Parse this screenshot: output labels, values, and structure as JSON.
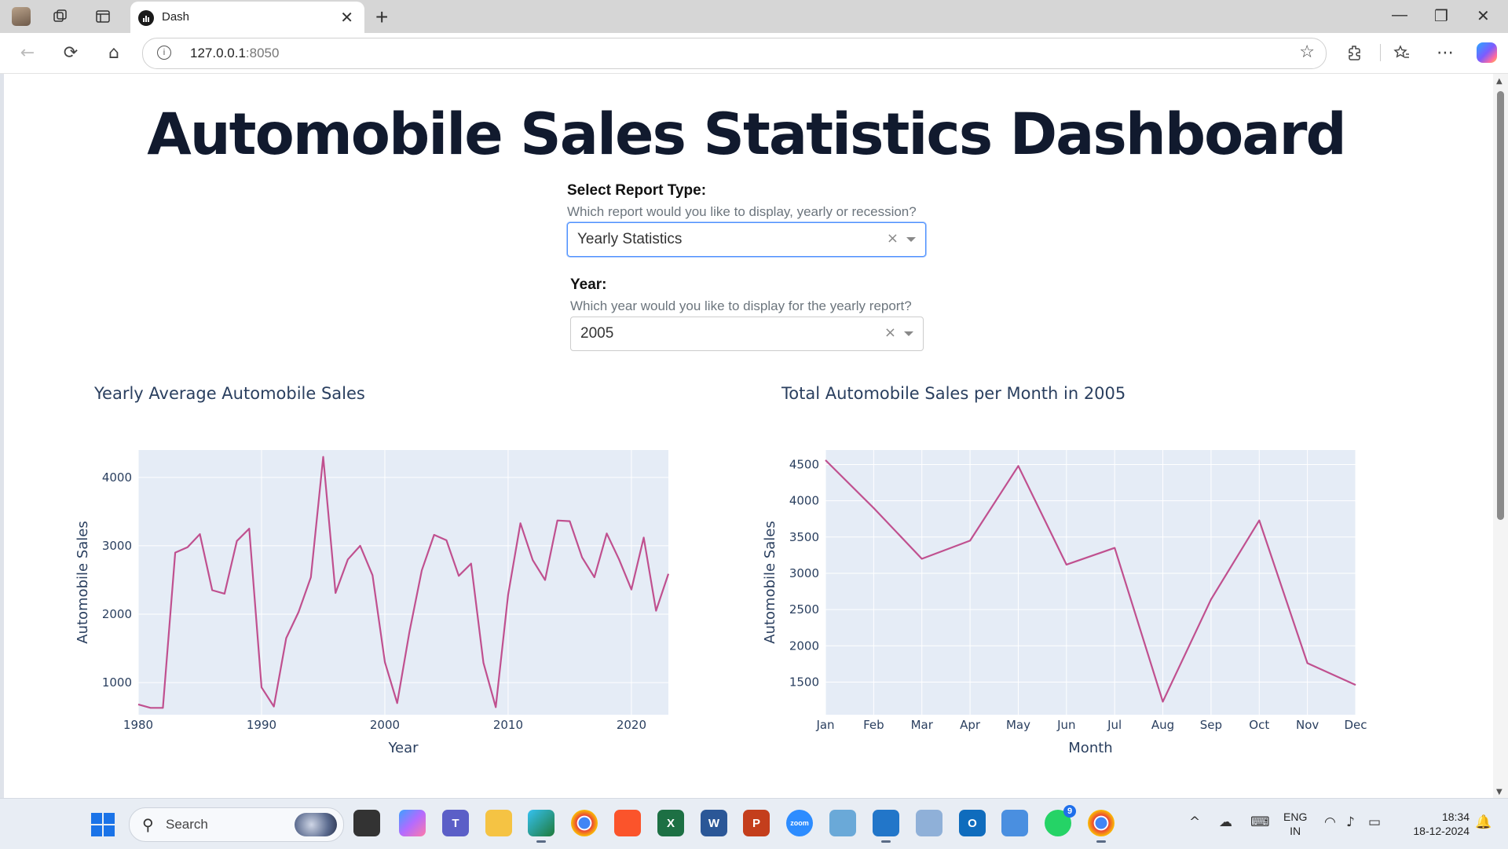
{
  "browser": {
    "tab_title": "Dash",
    "url_host": "127.0.0.1",
    "url_port": ":8050"
  },
  "page": {
    "title": "Automobile Sales Statistics Dashboard",
    "report_type": {
      "label": "Select Report Type:",
      "description": "Which report would you like to display, yearly or recession?",
      "value": "Yearly Statistics"
    },
    "year": {
      "label": "Year:",
      "description": "Which year would you like to display for the yearly report?",
      "value": "2005"
    }
  },
  "colors": {
    "line": "#c0508f",
    "plot_bg": "#e5ecf6",
    "grid": "#ffffff",
    "axis_text": "#2a3f5f",
    "title_text": "#111a2e"
  },
  "chart_data": [
    {
      "type": "line",
      "title": "Yearly Average Automobile Sales",
      "xlabel": "Year",
      "ylabel": "Automobile Sales",
      "xlim": [
        1980,
        2023
      ],
      "ylim": [
        530,
        4400
      ],
      "x_ticks": [
        1980,
        1990,
        2000,
        2010,
        2020
      ],
      "y_ticks": [
        1000,
        2000,
        3000,
        4000
      ],
      "grid": true,
      "x": [
        1980,
        1981,
        1982,
        1983,
        1984,
        1985,
        1986,
        1987,
        1988,
        1989,
        1990,
        1991,
        1992,
        1993,
        1994,
        1995,
        1996,
        1997,
        1998,
        1999,
        2000,
        2001,
        2002,
        2003,
        2004,
        2005,
        2006,
        2007,
        2008,
        2009,
        2010,
        2011,
        2012,
        2013,
        2014,
        2015,
        2016,
        2017,
        2018,
        2019,
        2020,
        2021,
        2022,
        2023
      ],
      "values": [
        680,
        630,
        630,
        2900,
        2980,
        3170,
        2350,
        2300,
        3070,
        3250,
        930,
        650,
        1650,
        2030,
        2540,
        4300,
        2310,
        2800,
        3000,
        2570,
        1300,
        700,
        1740,
        2640,
        3160,
        3080,
        2560,
        2740,
        1290,
        640,
        2280,
        3330,
        2790,
        2500,
        3370,
        3360,
        2830,
        2540,
        3180,
        2800,
        2360,
        3120,
        2050,
        2590
      ]
    },
    {
      "type": "line",
      "title": "Total Automobile Sales per Month in 2005",
      "xlabel": "Month",
      "ylabel": "Automobile Sales",
      "ylim": [
        1050,
        4700
      ],
      "y_ticks": [
        1500,
        2000,
        2500,
        3000,
        3500,
        4000,
        4500
      ],
      "grid": true,
      "categories": [
        "Jan",
        "Feb",
        "Mar",
        "Apr",
        "May",
        "Jun",
        "Jul",
        "Aug",
        "Sep",
        "Oct",
        "Nov",
        "Dec"
      ],
      "values": [
        4560,
        3900,
        3200,
        3450,
        4480,
        3120,
        3350,
        1230,
        2640,
        3730,
        1760,
        1460
      ]
    }
  ],
  "taskbar": {
    "search_label": "Search",
    "whatsapp_badge": "9",
    "lang_line1": "ENG",
    "lang_line2": "IN",
    "time": "18:34",
    "date": "18-12-2024"
  }
}
